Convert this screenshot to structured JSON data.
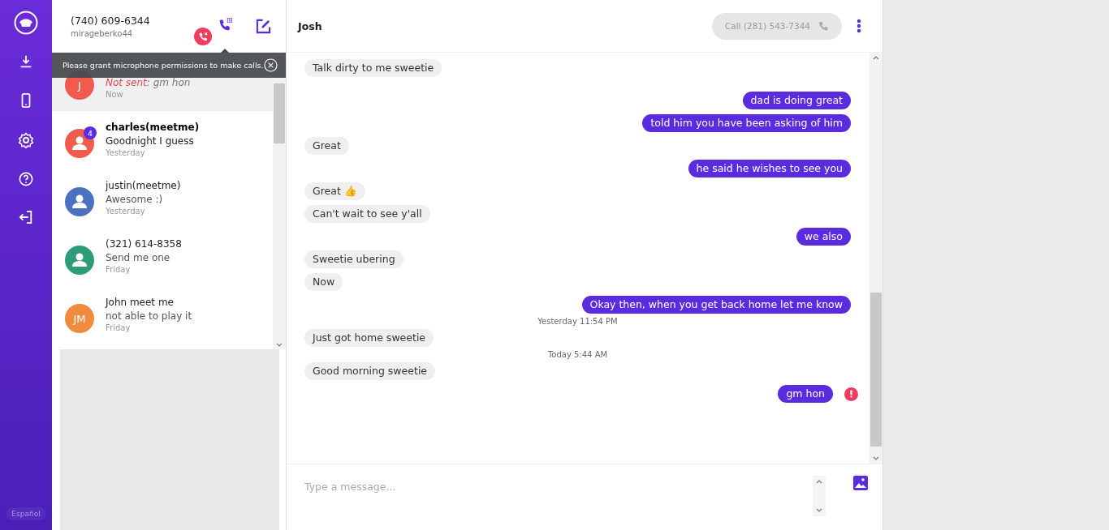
{
  "sidebar": {
    "items": [
      {
        "kind": "logo"
      },
      {
        "kind": "download"
      },
      {
        "kind": "phone"
      },
      {
        "kind": "settings"
      },
      {
        "kind": "help"
      },
      {
        "kind": "logout"
      }
    ],
    "language": "Español"
  },
  "account": {
    "number": "(740) 609-6344",
    "username": "mirageberko44",
    "mic_blocked": true
  },
  "toast": {
    "text": "Please grant microphone permissions to make calls."
  },
  "conversations": [
    {
      "status": "Not sent:",
      "preview": "gm hon",
      "time": "Now",
      "avatar_text": "J",
      "color": "#f05a4f",
      "selected": true,
      "unread": false
    },
    {
      "name": "charles(meetme)",
      "preview": "Goodnight I guess",
      "time": "Yesterday",
      "color": "#f05a4f",
      "badge": "4",
      "selected": false,
      "unread": true
    },
    {
      "name": "justin(meetme)",
      "preview": "Awesome :)",
      "time": "Yesterday",
      "color": "#4a72c0",
      "selected": false,
      "unread": false
    },
    {
      "name": "(321) 614-8358",
      "preview": "Send me one",
      "time": "Friday",
      "color": "#2e9c78",
      "selected": false,
      "unread": false
    },
    {
      "name": "John meet me",
      "preview": "not able to play it",
      "time": "Friday",
      "avatar_text": "JM",
      "color": "#f08a3c",
      "selected": false,
      "unread": false
    }
  ],
  "chat": {
    "contact": "Josh",
    "call_button": {
      "label": "Call (281) 543-7344",
      "disabled": true
    },
    "messages": [
      {
        "kind": "in",
        "text": "Talk dirty to me sweetie"
      },
      {
        "kind": "gap"
      },
      {
        "kind": "out",
        "text": "dad is doing great"
      },
      {
        "kind": "out",
        "text": "told him you have been asking of him"
      },
      {
        "kind": "in",
        "text": "Great"
      },
      {
        "kind": "out",
        "text": "he said he wishes to see you"
      },
      {
        "kind": "in",
        "text": "Great 👍"
      },
      {
        "kind": "in",
        "text": "Can't wait to see y'all"
      },
      {
        "kind": "out",
        "text": "we also"
      },
      {
        "kind": "in",
        "text": "Sweetie ubering"
      },
      {
        "kind": "in",
        "text": "Now"
      },
      {
        "kind": "out",
        "text": "Okay then, when you get back home let me know"
      },
      {
        "kind": "time",
        "text": "Yesterday 11:54 PM"
      },
      {
        "kind": "in",
        "text": "Just got home sweetie"
      },
      {
        "kind": "time",
        "text": "Today 5:44 AM"
      },
      {
        "kind": "in",
        "text": "Good morning sweetie"
      },
      {
        "kind": "out",
        "text": "gm hon",
        "failed": true
      }
    ],
    "input": {
      "placeholder": "Type a message..."
    }
  }
}
